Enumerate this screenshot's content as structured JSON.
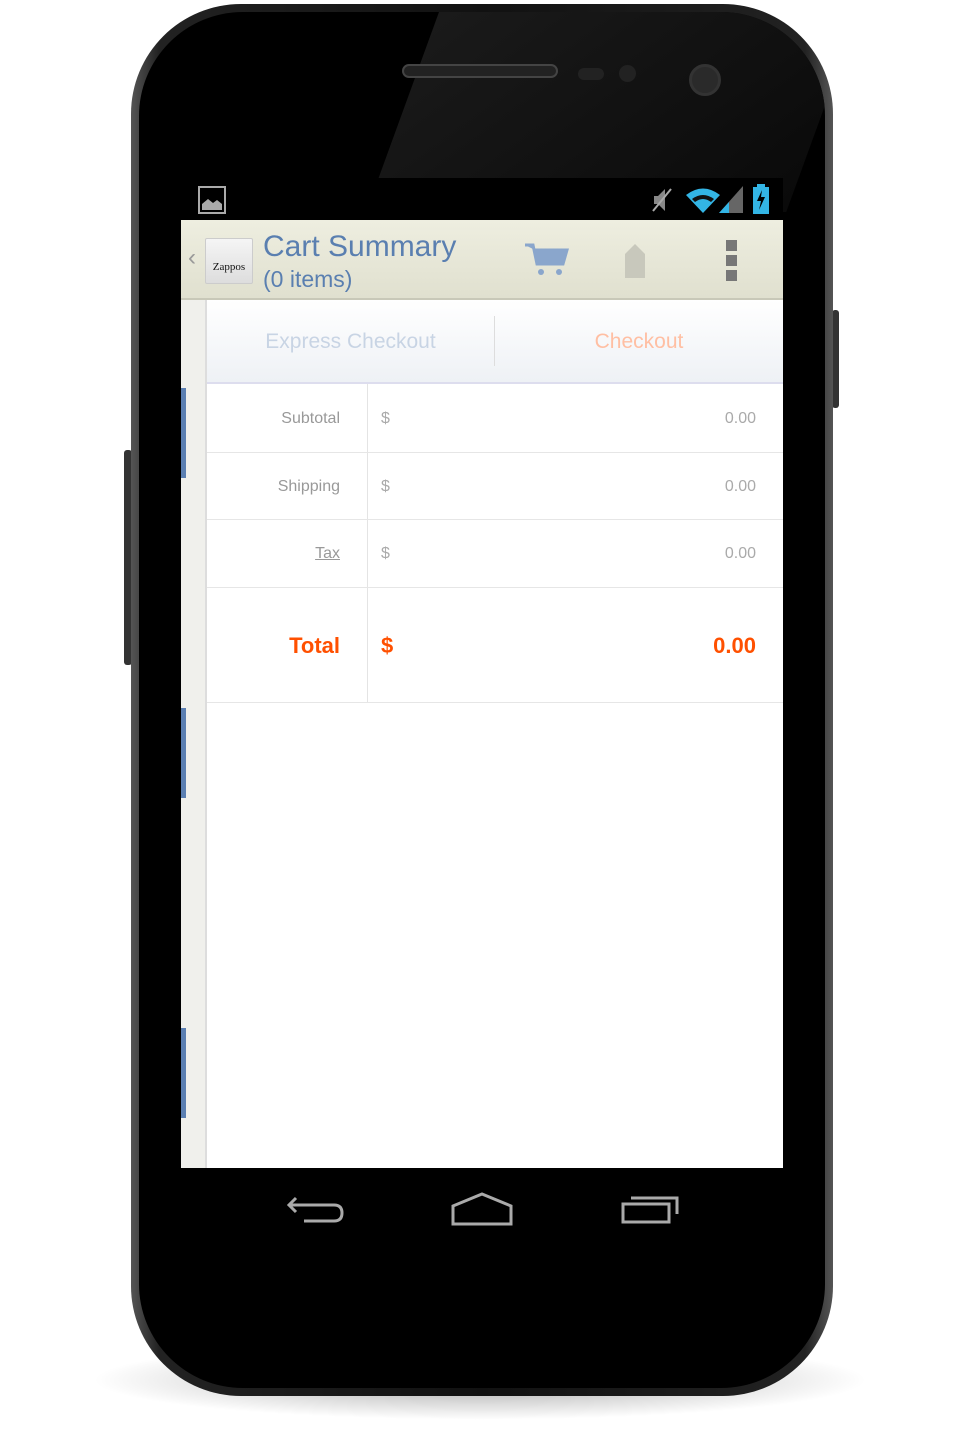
{
  "app": {
    "title": "Cart Summary",
    "subtitle": "(0 items)",
    "logo_text": "Zappos"
  },
  "status_icons": [
    "image-icon",
    "mute-icon",
    "wifi-icon",
    "signal-icon",
    "battery-charging-icon"
  ],
  "actions": [
    "cart-icon",
    "tag-icon",
    "overflow-menu-icon"
  ],
  "buttons": {
    "express": "Express Checkout",
    "checkout": "Checkout"
  },
  "summary": [
    {
      "label": "Subtotal",
      "currency": "$",
      "value": "0.00"
    },
    {
      "label": "Shipping",
      "currency": "$",
      "value": "0.00"
    },
    {
      "label": "Tax",
      "currency": "$",
      "value": "0.00"
    },
    {
      "label": "Total",
      "currency": "$",
      "value": "0.00"
    }
  ],
  "colors": {
    "accent": "#5a7fb0",
    "total": "#ff5000",
    "checkout": "#ffbfa3",
    "express": "#c8d4e4"
  }
}
